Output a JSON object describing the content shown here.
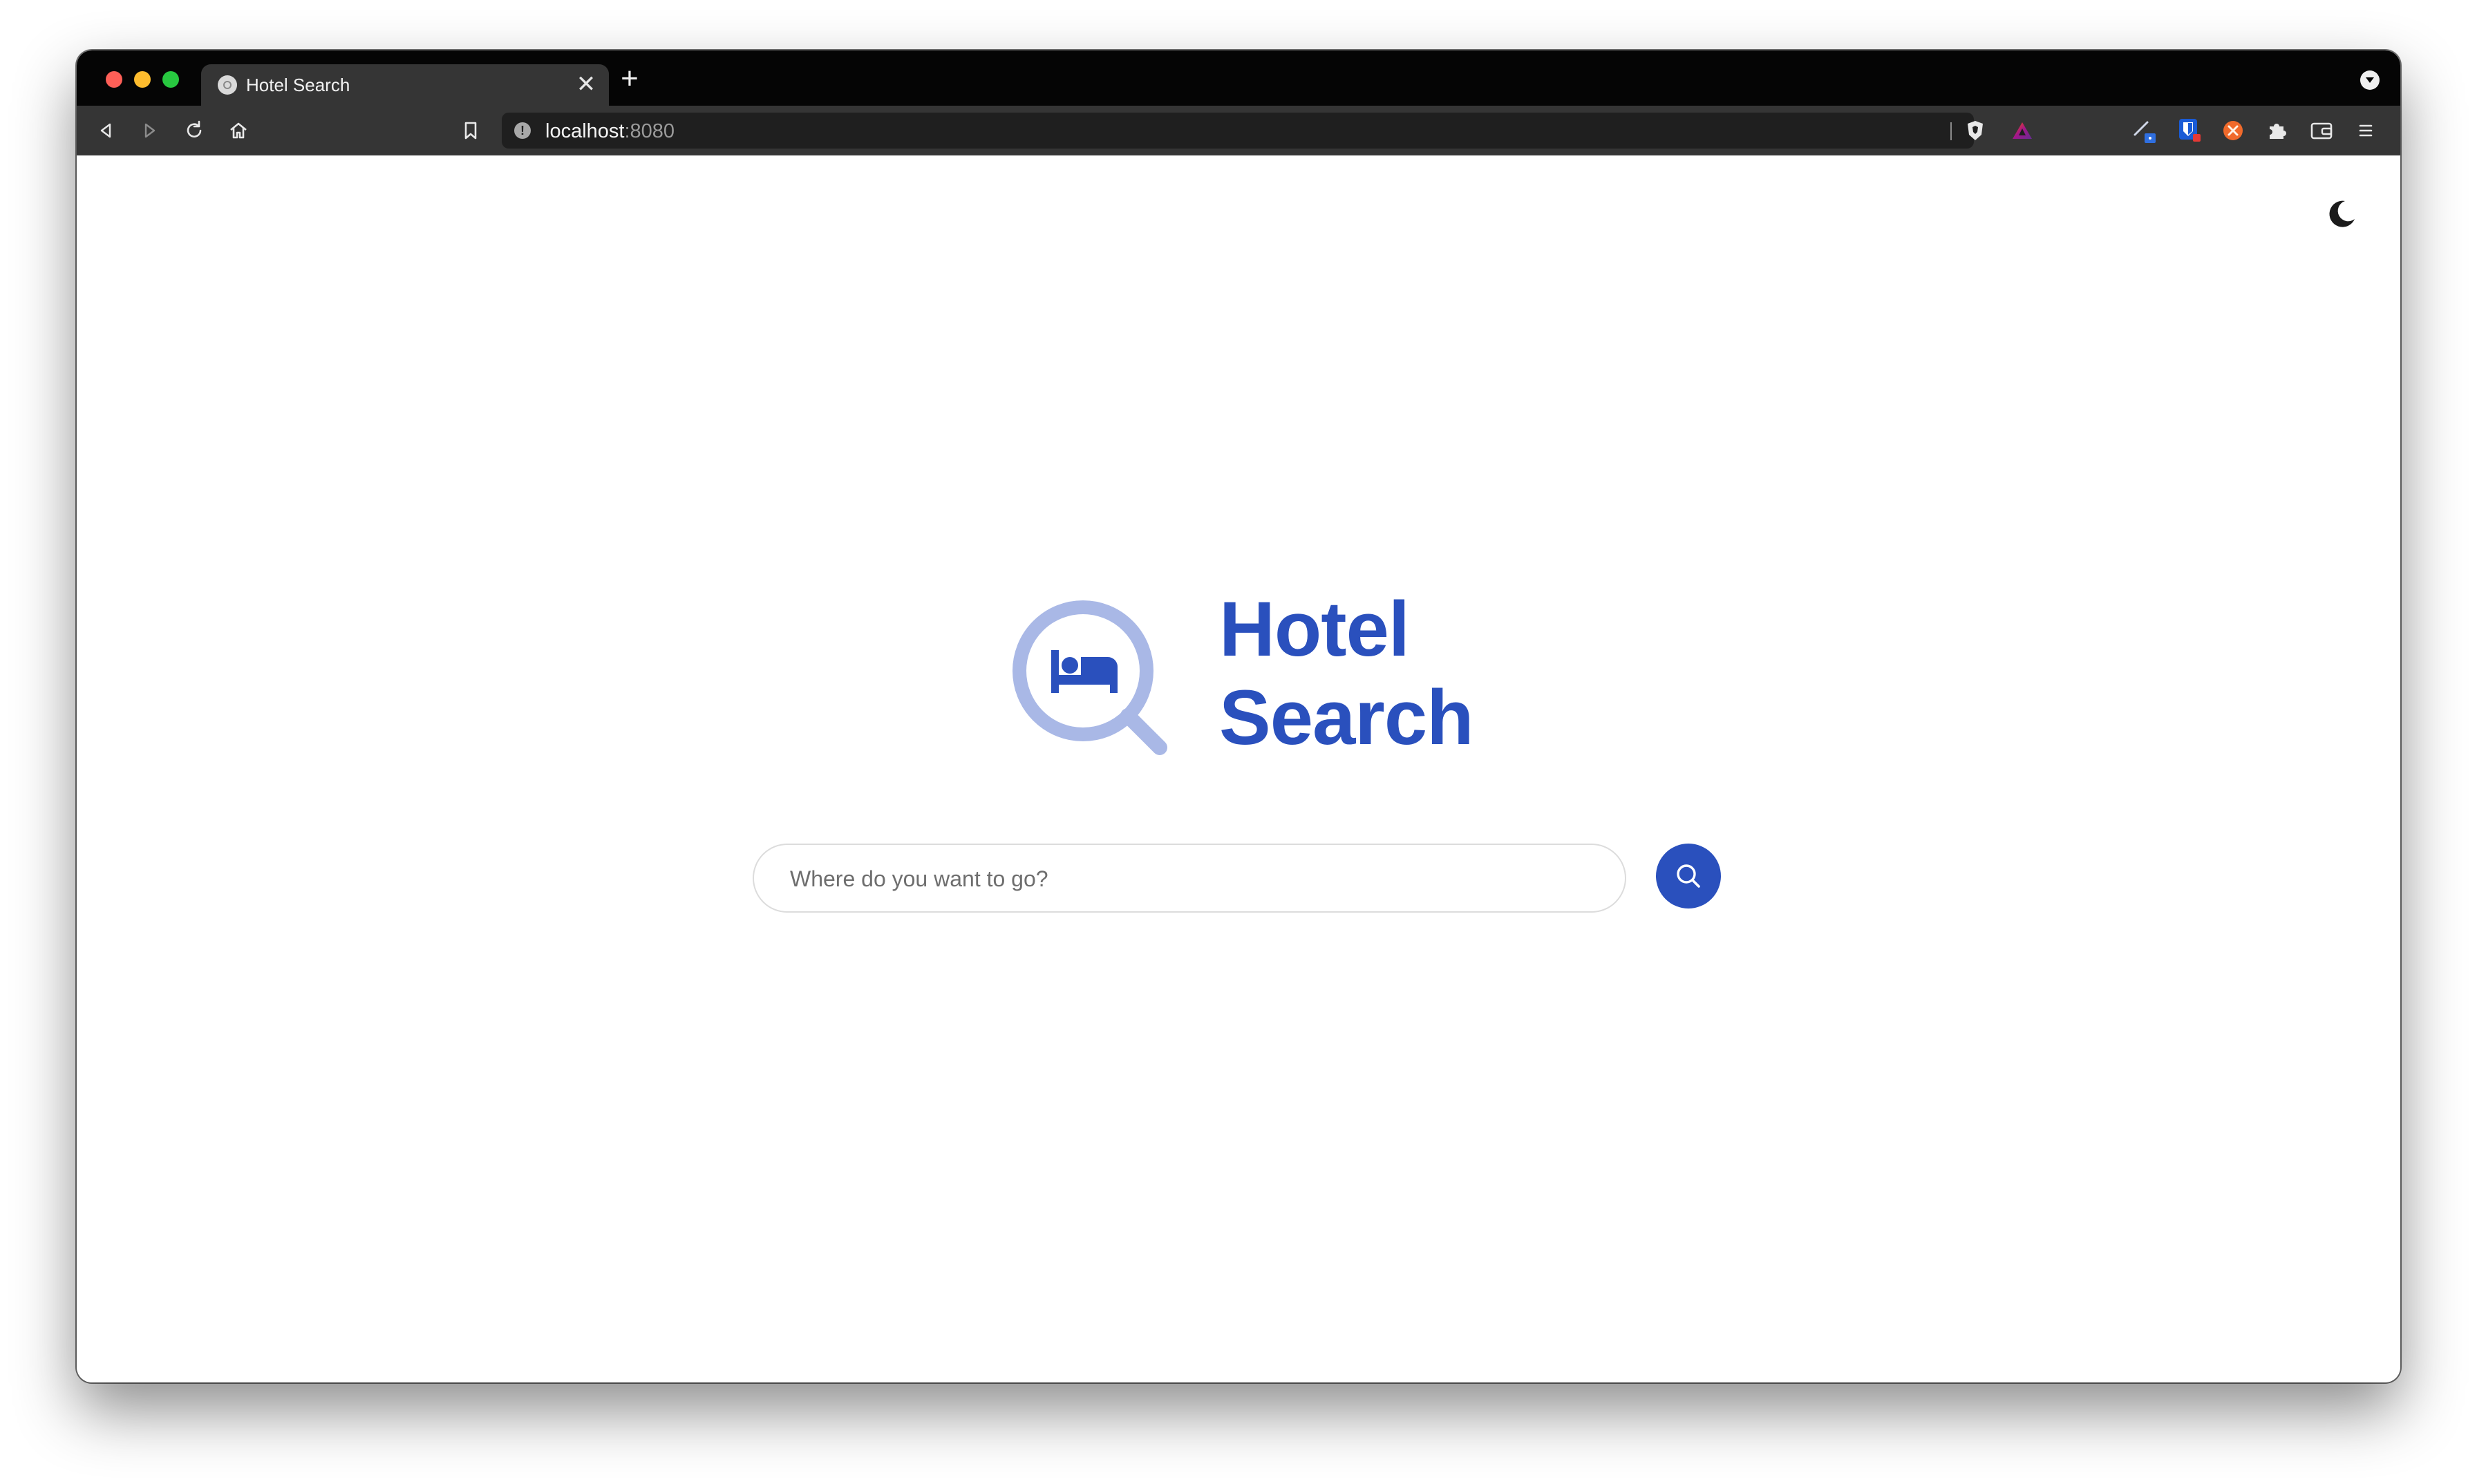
{
  "browser": {
    "tab": {
      "title": "Hotel Search",
      "close_glyph": "✕"
    },
    "new_tab_glyph": "+",
    "address_bar": {
      "host": "localhost",
      "port": ":8080",
      "info_glyph": "!"
    },
    "toolbar_icons": [
      "back-icon",
      "forward-icon",
      "reload-icon",
      "home-icon",
      "bookmark-icon"
    ],
    "extension_icons": [
      "brave-shield-icon",
      "brave-rewards-icon",
      "pen-extension-icon",
      "bitwarden-icon",
      "orange-extension-icon",
      "puzzle-icon",
      "wallet-icon",
      "menu-icon"
    ]
  },
  "page": {
    "theme_toggle_icon": "moon-icon",
    "brand": {
      "line1": "Hotel",
      "line2": "Search",
      "color": "#2a50bd",
      "logo_icon": "hotel-search-logo-icon"
    },
    "search": {
      "placeholder": "Where do you want to go?",
      "value": "",
      "button_icon": "search-icon"
    }
  }
}
